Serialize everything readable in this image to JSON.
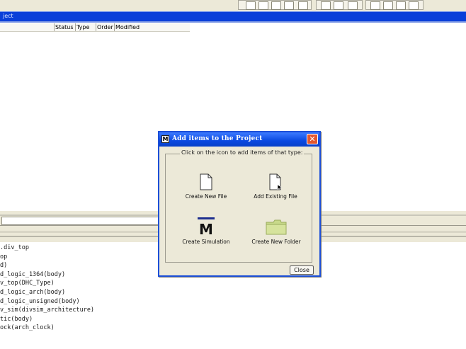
{
  "toolbar": {
    "groups": 3
  },
  "project_pane": {
    "title": "ject",
    "columns": [
      "Status",
      "Type",
      "Order",
      "Modified"
    ]
  },
  "transcript": {
    "lines": [
      ".div_top",
      "op",
      "d)",
      "d_logic_1364(body)",
      "v_top(DHC_Type)",
      "d_logic_arch(body)",
      "d_logic_unsigned(body)",
      "v_sim(divsim_architecture)",
      "tic(body)",
      "ock(arch_clock)"
    ]
  },
  "dialog": {
    "title": "Add items to the Project",
    "app_icon": "M",
    "instruction": "Click on the icon to add items of that type:",
    "items": [
      {
        "label": "Create New File",
        "icon": "new-file-icon"
      },
      {
        "label": "Add Existing File",
        "icon": "existing-file-icon"
      },
      {
        "label": "Create Simulation",
        "icon": "simulation-icon",
        "glyph": "M"
      },
      {
        "label": "Create New Folder",
        "icon": "folder-icon"
      }
    ],
    "close_label": "Close"
  },
  "colors": {
    "title_blue": "#0a3fd9",
    "dialog_bg": "#ece9d8",
    "close_red": "#e2562e",
    "folder_green": "#c8d98a"
  }
}
